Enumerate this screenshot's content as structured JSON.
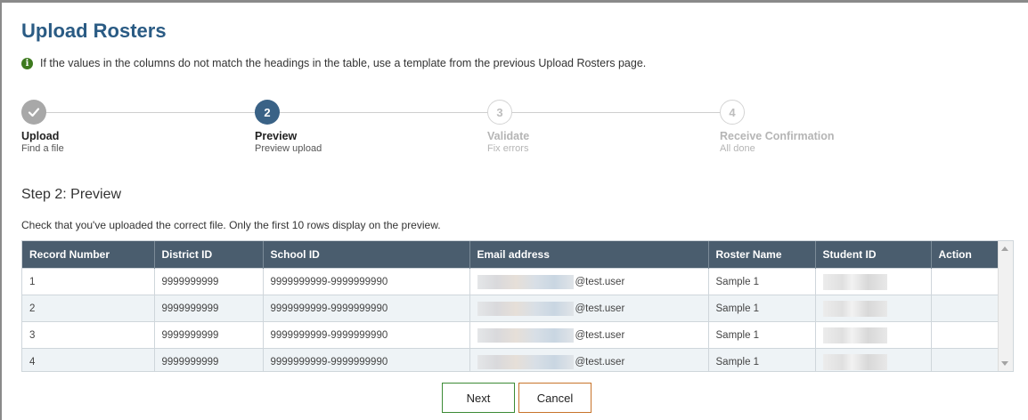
{
  "page": {
    "title": "Upload Rosters",
    "notice": "If the values in the columns do not match the headings in the table, use a template from the previous Upload Rosters page."
  },
  "stepper": {
    "steps": [
      {
        "number": "",
        "title": "Upload",
        "subtitle": "Find a file",
        "state": "done"
      },
      {
        "number": "2",
        "title": "Preview",
        "subtitle": "Preview upload",
        "state": "active"
      },
      {
        "number": "3",
        "title": "Validate",
        "subtitle": "Fix errors",
        "state": "future"
      },
      {
        "number": "4",
        "title": "Receive Confirmation",
        "subtitle": "All done",
        "state": "future"
      }
    ]
  },
  "section": {
    "heading": "Step 2: Preview",
    "description": "Check that you've uploaded the correct file. Only the first 10 rows display on the preview."
  },
  "table": {
    "columns": [
      "Record Number",
      "District ID",
      "School ID",
      "Email address",
      "Roster Name",
      "Student ID",
      "Action"
    ],
    "rows": [
      {
        "record": "1",
        "district": "9999999999",
        "school": "9999999999-9999999990",
        "email_suffix": "@test.user",
        "roster": "Sample 1",
        "action": ""
      },
      {
        "record": "2",
        "district": "9999999999",
        "school": "9999999999-9999999990",
        "email_suffix": "@test.user",
        "roster": "Sample 1",
        "action": ""
      },
      {
        "record": "3",
        "district": "9999999999",
        "school": "9999999999-9999999990",
        "email_suffix": "@test.user",
        "roster": "Sample 1",
        "action": ""
      },
      {
        "record": "4",
        "district": "9999999999",
        "school": "9999999999-9999999990",
        "email_suffix": "@test.user",
        "roster": "Sample 1",
        "action": ""
      }
    ]
  },
  "buttons": {
    "next": "Next",
    "cancel": "Cancel"
  },
  "colors": {
    "title": "#2a5b84",
    "header_bg": "#4a5d6e",
    "active_step": "#3a6286",
    "next_border": "#3c8b35",
    "cancel_border": "#c8742b"
  }
}
